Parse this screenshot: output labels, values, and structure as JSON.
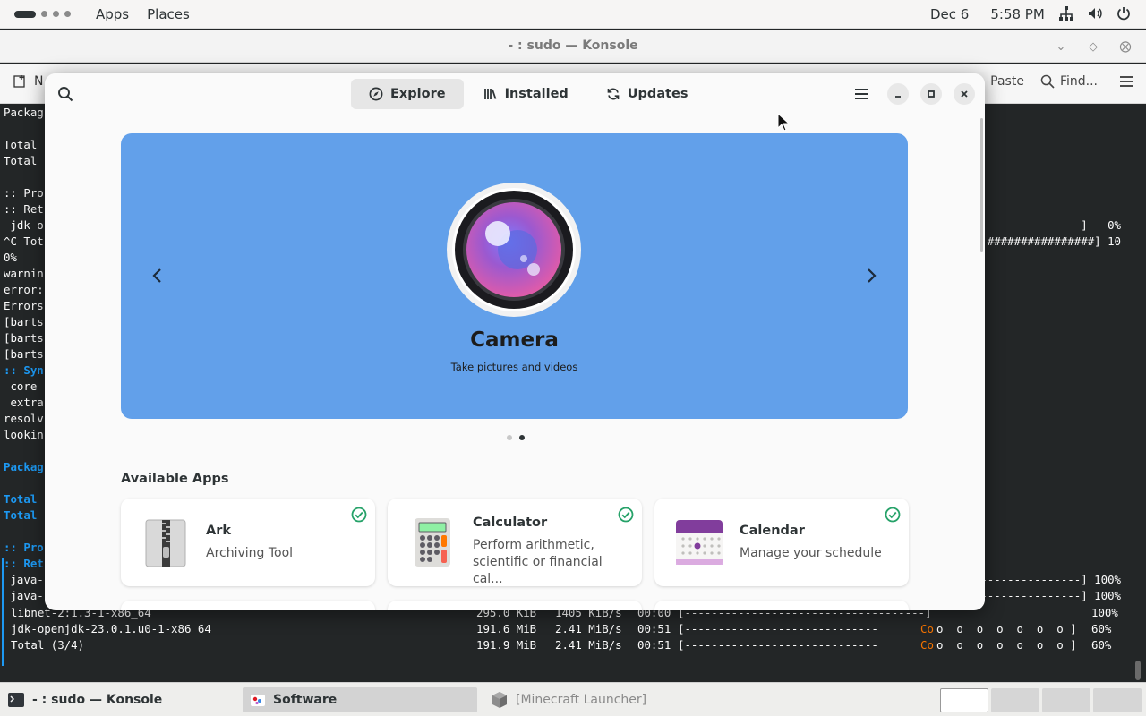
{
  "topbar": {
    "apps_label": "Apps",
    "places_label": "Places",
    "date": "Dec 6",
    "time": "5:58 PM"
  },
  "konsole": {
    "title": "- : sudo — Konsole",
    "toolbar": {
      "new_tab_label": "N",
      "paste_label": "Paste",
      "find_label": "Find..."
    },
    "lines_left": [
      {
        "text": "Packag",
        "cyan": false
      },
      {
        "text": "",
        "cyan": false
      },
      {
        "text": "Total",
        "cyan": false
      },
      {
        "text": "Total",
        "cyan": false
      },
      {
        "text": "",
        "cyan": false
      },
      {
        "text": ":: Pro",
        "cyan": false
      },
      {
        "text": ":: Ret",
        "cyan": false
      },
      {
        "text": " jdk-o",
        "cyan": false
      },
      {
        "text": "^C Tot",
        "cyan": false
      },
      {
        "text": "0%",
        "cyan": false
      },
      {
        "text": "warnin",
        "cyan": false
      },
      {
        "text": "error:",
        "cyan": false
      },
      {
        "text": "Errors",
        "cyan": false
      },
      {
        "text": "[barts",
        "cyan": false
      },
      {
        "text": "[barts",
        "cyan": false
      },
      {
        "text": "[barts",
        "cyan": false
      },
      {
        "text": ":: Syn",
        "cyan": true
      },
      {
        "text": " core",
        "cyan": false
      },
      {
        "text": " extra",
        "cyan": false
      },
      {
        "text": "resolv",
        "cyan": false
      },
      {
        "text": "lookin",
        "cyan": false
      },
      {
        "text": "",
        "cyan": false
      },
      {
        "text": "Packag",
        "cyan": true
      },
      {
        "text": "",
        "cyan": false
      },
      {
        "text": "Total",
        "cyan": true
      },
      {
        "text": "Total",
        "cyan": true
      },
      {
        "text": "",
        "cyan": false
      },
      {
        "text": ":: Pro",
        "cyan": true
      },
      {
        "text": ":: Ret",
        "cyan": true
      },
      {
        "text": " java-",
        "cyan": false
      },
      {
        "text": " java-",
        "cyan": false
      }
    ],
    "lines_right_top": [
      {
        "text": "----------------]   0%"
      },
      {
        "text": "################] 10"
      }
    ],
    "lines_right_mid": [
      {
        "text": "----------------] 100%"
      },
      {
        "text": "----------------] 100%"
      }
    ],
    "lines_bottom": [
      {
        "name": "libnet-2:1.3-1-x86_64",
        "size": "295.0 KiB",
        "rate": "1405 KiB/s",
        "eta": "00:00",
        "bar": "[------------------------------------]",
        "pct": "100%",
        "co": false
      },
      {
        "name": "jdk-openjdk-23.0.1.u0-1-x86_64",
        "size": "191.6 MiB",
        "rate": "2.41 MiB/s",
        "eta": "00:51",
        "bar": "[-----------------------------",
        "pct": "60%",
        "co": true
      },
      {
        "name": "Total (3/4)",
        "size": "191.9 MiB",
        "rate": "2.41 MiB/s",
        "eta": "00:51",
        "bar": "[-----------------------------",
        "pct": "60%",
        "co": true
      }
    ],
    "co_text": "Co",
    "co_dots": "o  o  o  o  o  o  o ]"
  },
  "software": {
    "tabs": [
      {
        "label": "Explore",
        "icon": "compass-icon",
        "active": true
      },
      {
        "label": "Installed",
        "icon": "library-icon",
        "active": false
      },
      {
        "label": "Updates",
        "icon": "refresh-icon",
        "active": false
      }
    ],
    "carousel": {
      "title": "Camera",
      "subtitle": "Take pictures and videos",
      "color": "#62a0ea",
      "pages": 2,
      "current_page": 2
    },
    "available_title": "Available Apps",
    "apps": [
      {
        "name": "Ark",
        "desc": "Archiving Tool",
        "icon": "ark-icon",
        "installed": true
      },
      {
        "name": "Calculator",
        "desc": "Perform arithmetic, scientific or financial cal...",
        "icon": "calculator-icon",
        "installed": true
      },
      {
        "name": "Calendar",
        "desc": "Manage your schedule",
        "icon": "calendar-icon",
        "installed": true
      }
    ]
  },
  "taskbar": {
    "tasks": [
      {
        "label": "- : sudo — Konsole"
      },
      {
        "label": "Software"
      },
      {
        "label": "[Minecraft Launcher]"
      }
    ]
  }
}
